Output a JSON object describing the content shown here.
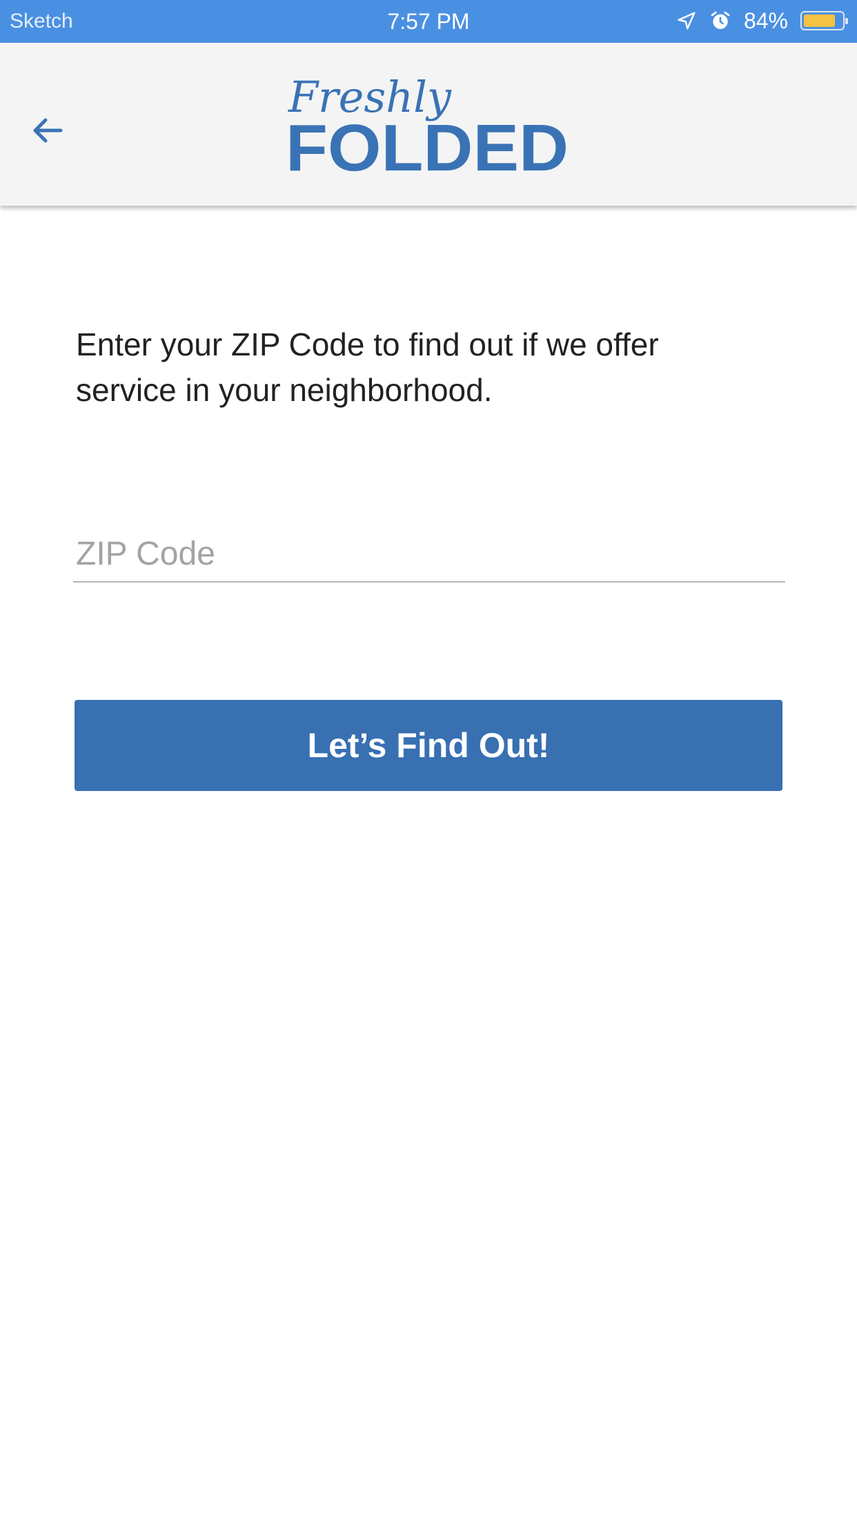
{
  "status_bar": {
    "carrier": "Sketch",
    "time": "7:57 PM",
    "battery_percent": "84%",
    "battery_level": 0.84,
    "icons": [
      "location-arrow-icon",
      "alarm-icon",
      "battery-icon"
    ]
  },
  "header": {
    "back_icon": "back-arrow-icon",
    "logo_line1": "Freshly",
    "logo_line2": "FOLDED",
    "brand_color": "#3a73b5"
  },
  "main": {
    "intro_text": "Enter your ZIP Code to find out if we offer service in your neighborhood.",
    "zip_placeholder": "ZIP Code",
    "zip_value": "",
    "find_button_label": "Let’s Find Out!"
  },
  "colors": {
    "status_bar": "#4a90e2",
    "button": "#3870b2",
    "battery": "#f5c242"
  }
}
